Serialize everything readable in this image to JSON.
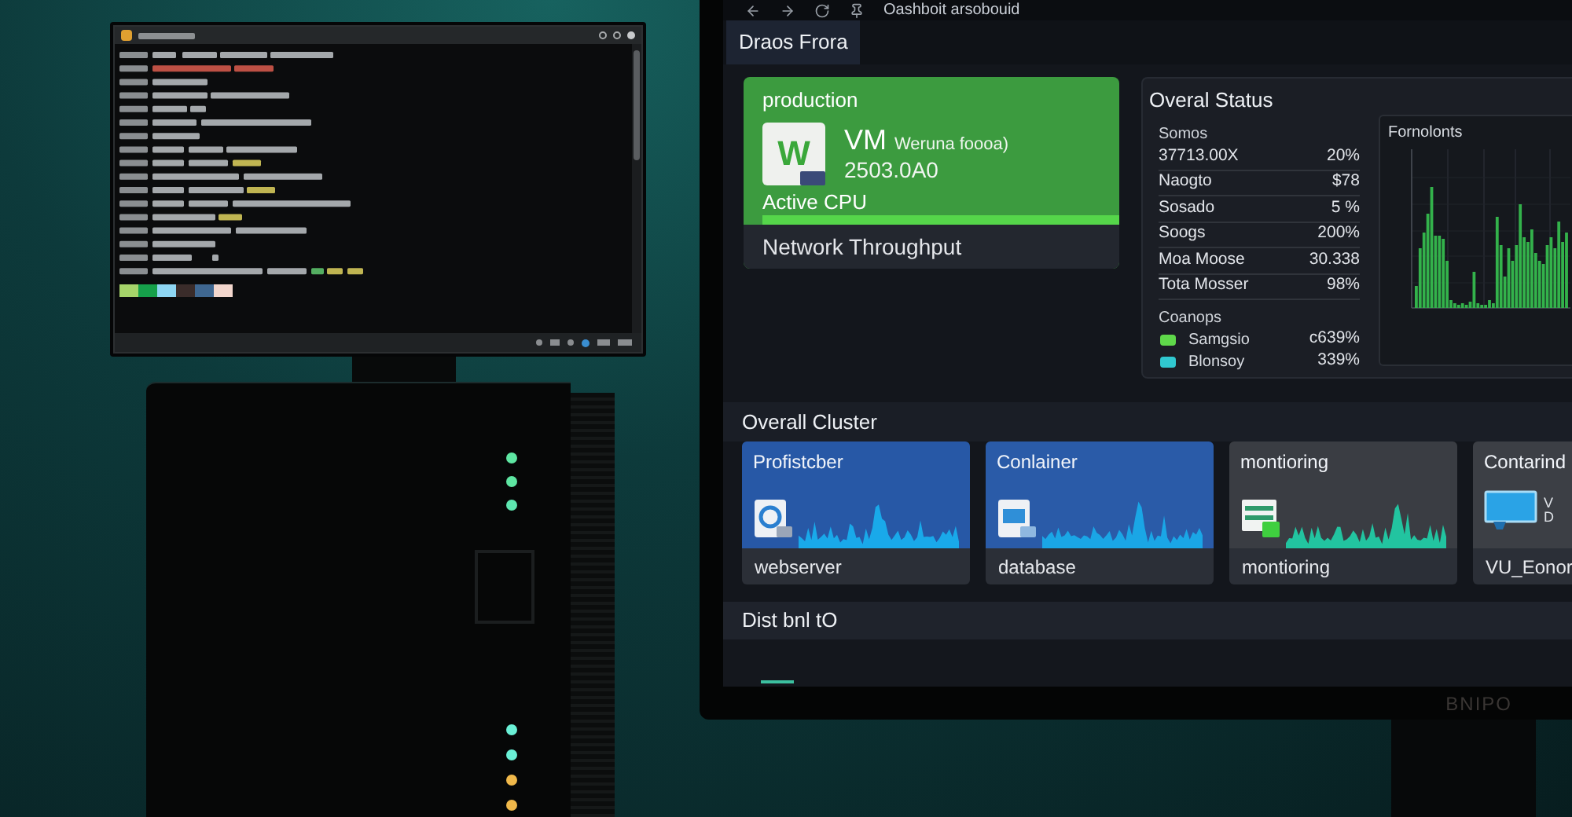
{
  "terminal": {
    "swatches": [
      {
        "color": "#a6d46a"
      },
      {
        "color": "#16a04a"
      },
      {
        "color": "#8ed6f2"
      },
      {
        "color": "#3a2c2a"
      },
      {
        "color": "#3f6790"
      },
      {
        "color": "#f2d6cc"
      }
    ]
  },
  "server": {
    "led_groups": [
      {
        "leds": [
          {
            "color": "#5ee6a2"
          },
          {
            "color": "#5ee6a2"
          },
          {
            "color": "#5ee6b0"
          }
        ]
      },
      {
        "leds": [
          {
            "color": "#6af0d6"
          },
          {
            "color": "#6af0d6"
          },
          {
            "color": "#f0b84a"
          },
          {
            "color": "#f0b84a"
          }
        ]
      }
    ]
  },
  "dashboard": {
    "title": "Oashboit arsobouid",
    "tabs": [
      {
        "label": "Draos Frora",
        "selected": true
      }
    ],
    "production_card": {
      "label": "production",
      "logo_letter": "W",
      "name": "VM",
      "detail": "Weruna foooa)",
      "value": "2503.0A0",
      "metric": "Active CPU",
      "level": 1,
      "footer": "Network Throughput"
    },
    "overall_status": {
      "title": "Overal Status",
      "header": "Somos",
      "rows": [
        {
          "label": "37713.00X",
          "value": "20%"
        },
        {
          "label": "Naogto",
          "value": "$78"
        },
        {
          "label": "Sosado",
          "value": "5 %"
        },
        {
          "label": "Soogs",
          "value": "200%"
        },
        {
          "label": "Moa Moose",
          "value": "30.338"
        },
        {
          "label": "Tota Mosser",
          "value": "98%"
        }
      ],
      "legend_title": "Coanops",
      "legend": [
        {
          "label": "Samgsio",
          "value": "c639%",
          "color": "#5fd84a"
        },
        {
          "label": "Blonsoy",
          "value": "339%",
          "color": "#30c8d0"
        }
      ],
      "chart": {
        "title": "Fornolonts"
      }
    },
    "cluster": {
      "title": "Overall Cluster",
      "cards": [
        {
          "kind": "waveform",
          "name": "Profistcber",
          "color": "#2758a6",
          "footer": "webserver"
        },
        {
          "kind": "waveform",
          "name": "Conlainer",
          "color": "#2a5ba8",
          "footer": "database"
        },
        {
          "kind": "waveform",
          "name": "montioring",
          "color": "#3a3d43",
          "footer": "montioring"
        },
        {
          "kind": "detail",
          "name": "Contarind",
          "color": "#3c3f45",
          "detail_lines": [
            "V",
            "D"
          ],
          "footer": "VU_Eonor"
        }
      ]
    },
    "distribution": {
      "title": "Dist bnl tO"
    }
  },
  "monitor": {
    "brand": "BNIPO"
  }
}
